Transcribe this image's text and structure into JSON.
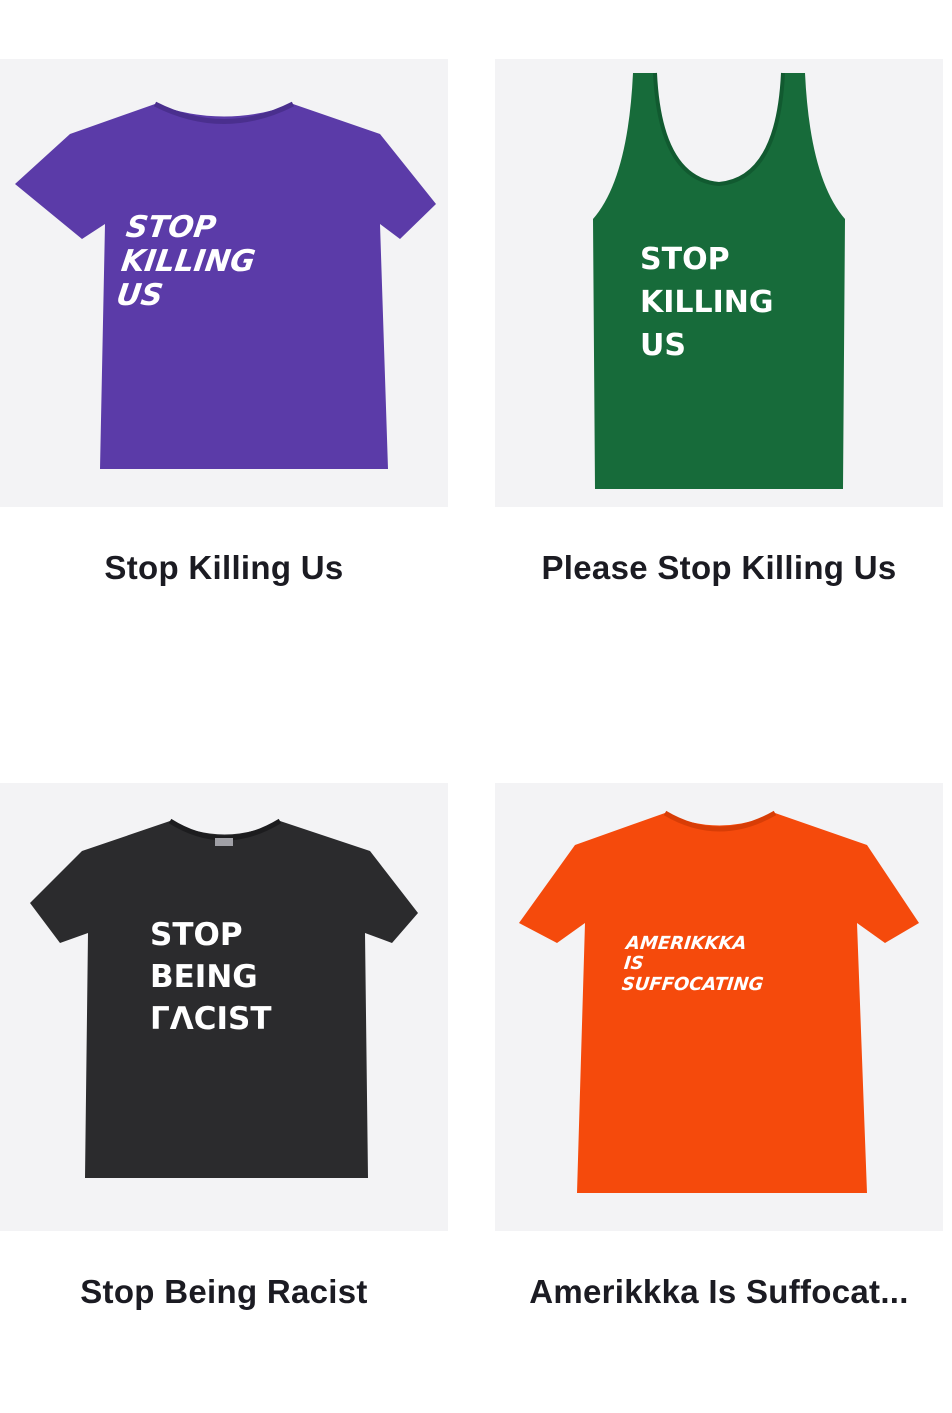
{
  "products": [
    {
      "title": "Stop Killing Us",
      "garment": "t-shirt",
      "color": "#5b3ba8",
      "print_lines": [
        "STOP",
        "KILLING",
        "US"
      ]
    },
    {
      "title": "Please Stop Killing Us",
      "garment": "tank-top",
      "color": "#176b3a",
      "print_lines": [
        "STOP",
        "KILLING",
        "US"
      ]
    },
    {
      "title": "Stop Being Racist",
      "garment": "t-shirt",
      "color": "#2b2b2d",
      "print_lines": [
        "STOP",
        "BEING",
        "ΓΛCIST"
      ]
    },
    {
      "title": "Amerikkka Is Suffocat...",
      "garment": "t-shirt",
      "color": "#f54a0c",
      "print_lines": [
        "AMERIKKKA",
        "IS",
        "SUFFOCATING"
      ]
    }
  ]
}
